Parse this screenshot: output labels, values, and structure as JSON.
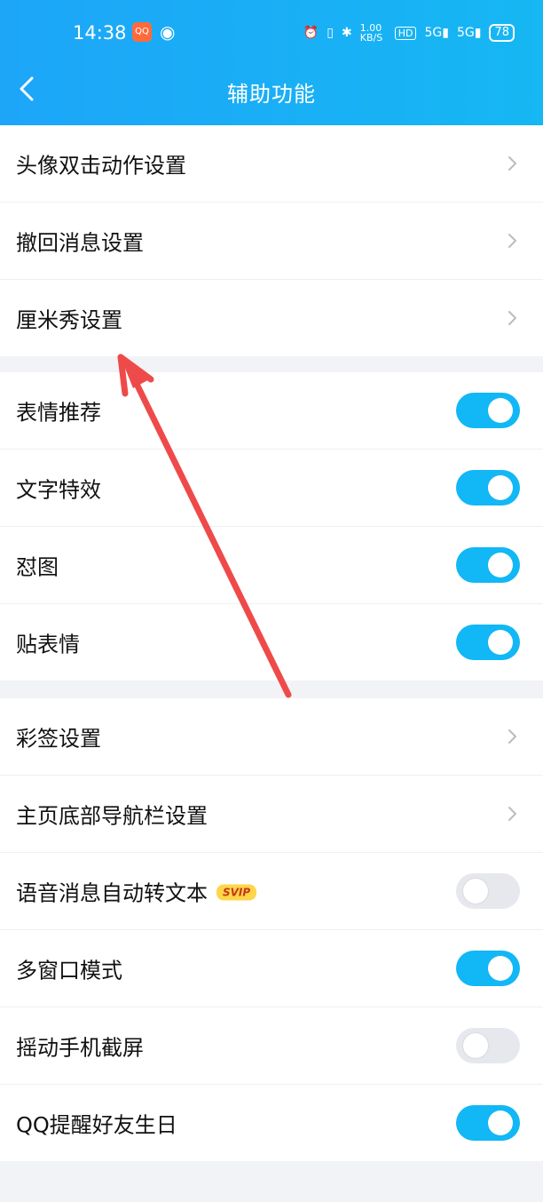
{
  "status_bar": {
    "time": "14:38",
    "app_badge": "QQ",
    "network_speed": "1.00 KB/S",
    "hd": "HD",
    "signal1": "5G",
    "signal2": "5G",
    "battery": "78"
  },
  "header": {
    "title": "辅助功能"
  },
  "groups": [
    {
      "items": [
        {
          "label": "头像双击动作设置",
          "type": "nav"
        },
        {
          "label": "撤回消息设置",
          "type": "nav"
        },
        {
          "label": "厘米秀设置",
          "type": "nav"
        }
      ]
    },
    {
      "items": [
        {
          "label": "表情推荐",
          "type": "toggle",
          "on": true
        },
        {
          "label": "文字特效",
          "type": "toggle",
          "on": true
        },
        {
          "label": "怼图",
          "type": "toggle",
          "on": true
        },
        {
          "label": "贴表情",
          "type": "toggle",
          "on": true
        }
      ]
    },
    {
      "items": [
        {
          "label": "彩签设置",
          "type": "nav"
        },
        {
          "label": "主页底部导航栏设置",
          "type": "nav"
        },
        {
          "label": "语音消息自动转文本",
          "badge": "SVIP",
          "type": "toggle",
          "on": false
        },
        {
          "label": "多窗口模式",
          "type": "toggle",
          "on": true
        },
        {
          "label": "摇动手机截屏",
          "type": "toggle",
          "on": false
        },
        {
          "label": "QQ提醒好友生日",
          "type": "toggle",
          "on": true
        }
      ]
    }
  ],
  "colors": {
    "accent": "#12b7f5",
    "header": "#1da6f8",
    "annotation_arrow": "#ef4a4a"
  }
}
